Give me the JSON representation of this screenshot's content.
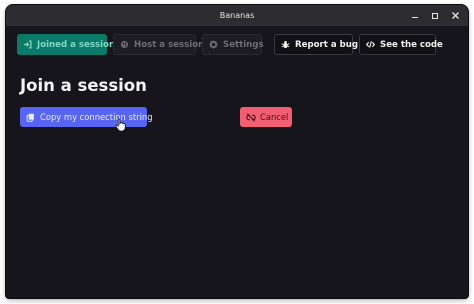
{
  "window": {
    "title": "Bananas"
  },
  "toolbar": {
    "joined": "Joined a session",
    "host": "Host a session",
    "settings": "Settings",
    "report": "Report a bug",
    "code": "See the code"
  },
  "main": {
    "heading": "Join a session",
    "copy_button": "Copy my connection string",
    "cancel_button": "Cancel"
  },
  "colors": {
    "active_tab": "#0b7a68",
    "primary": "#5865f2",
    "danger": "#f25f72",
    "background": "#16151c"
  },
  "icons": {
    "joined": "sign-in-icon",
    "host": "globe-icon",
    "settings": "gear-icon",
    "report": "bug-icon",
    "code": "code-icon",
    "copy": "copy-icon",
    "cancel": "broken-link-icon"
  }
}
